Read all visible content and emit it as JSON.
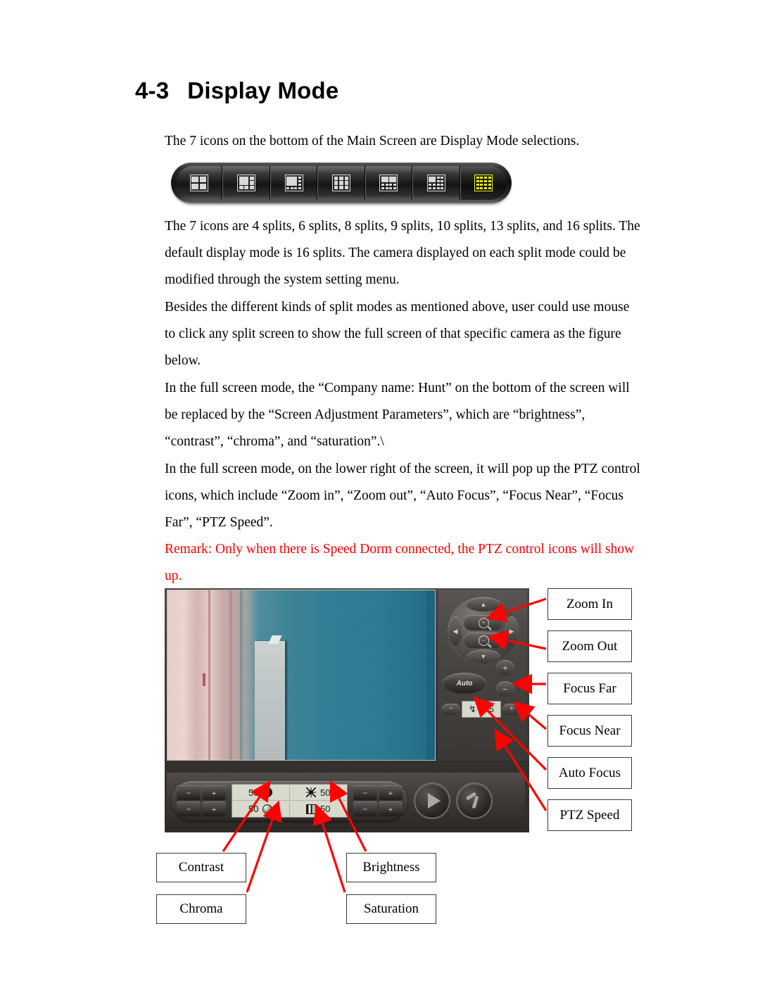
{
  "heading": {
    "number": "4-3",
    "title": "Display Mode"
  },
  "paragraphs": {
    "p1": "The 7 icons on the bottom of the Main Screen are Display Mode selections.",
    "p2": "The 7 icons are 4 splits, 6 splits, 8 splits, 9 splits, 10 splits, 13 splits, and 16 splits. The default display mode is 16 splits. The camera displayed on each split mode could be modified through the system setting menu.",
    "p3": "Besides the different kinds of split modes as mentioned above, user could use mouse to click any split screen to show the full screen of that specific camera as the figure below.",
    "p4": "In the full screen mode, the “Company name: Hunt” on the bottom of the screen will be replaced by the “Screen Adjustment Parameters”, which are “brightness”, “contrast”, “chroma”, and “saturation”.\\",
    "p5": "In the full screen mode, on the lower right of the screen, it will pop up the PTZ control icons, which include “Zoom in”, “Zoom out”, “Auto Focus”, “Focus Near”, “Focus Far”, “PTZ Speed”.",
    "remark": "Remark: Only when there is Speed Dorm connected, the PTZ control icons will show up.",
    "remark_color": "#ff0000"
  },
  "toolbar": {
    "active_index": 6,
    "active_color": "#f5f000",
    "icon_color": "#d8d8d8",
    "buttons": [
      {
        "name": "split-4",
        "label": "4 splits",
        "cells": 4
      },
      {
        "name": "split-6",
        "label": "6 splits",
        "cells": 6
      },
      {
        "name": "split-8",
        "label": "8 splits",
        "cells": 8
      },
      {
        "name": "split-9",
        "label": "9 splits",
        "cells": 9
      },
      {
        "name": "split-10",
        "label": "10 splits",
        "cells": 10
      },
      {
        "name": "split-13",
        "label": "13 splits",
        "cells": 13
      },
      {
        "name": "split-16",
        "label": "16 splits",
        "cells": 16
      }
    ]
  },
  "dvr": {
    "ptz": {
      "up": "▲",
      "down": "▼",
      "left": "◀",
      "right": "▶",
      "zoom_in": "+",
      "zoom_out": "−",
      "auto_label": "Auto",
      "focus_plus": "+",
      "focus_minus": "−",
      "speed_minus": "−",
      "speed_plus": "+",
      "speed_icon": "↯",
      "speed_value": "5"
    },
    "params": [
      {
        "name": "contrast",
        "value": "50",
        "icon": "contrast-icon",
        "icon_side": "right"
      },
      {
        "name": "brightness",
        "value": "50",
        "icon": "brightness-icon",
        "icon_side": "left"
      },
      {
        "name": "chroma",
        "value": "50",
        "icon": "chroma-icon",
        "icon_side": "right"
      },
      {
        "name": "saturation",
        "value": "50",
        "icon": "saturation-icon",
        "icon_side": "left"
      }
    ],
    "pad_keys": {
      "minus": "−",
      "plus": "+"
    },
    "action_buttons": [
      {
        "name": "play-button",
        "icon": "play-icon"
      },
      {
        "name": "tools-button",
        "icon": "hammer-icon"
      }
    ]
  },
  "callouts": {
    "right": [
      "Zoom In",
      "Zoom Out",
      "Focus Far",
      "Focus Near",
      "Auto Focus",
      "PTZ Speed"
    ],
    "bottom": [
      "Contrast",
      "Brightness",
      "Chroma",
      "Saturation"
    ],
    "arrow_color": "#ff0000"
  }
}
